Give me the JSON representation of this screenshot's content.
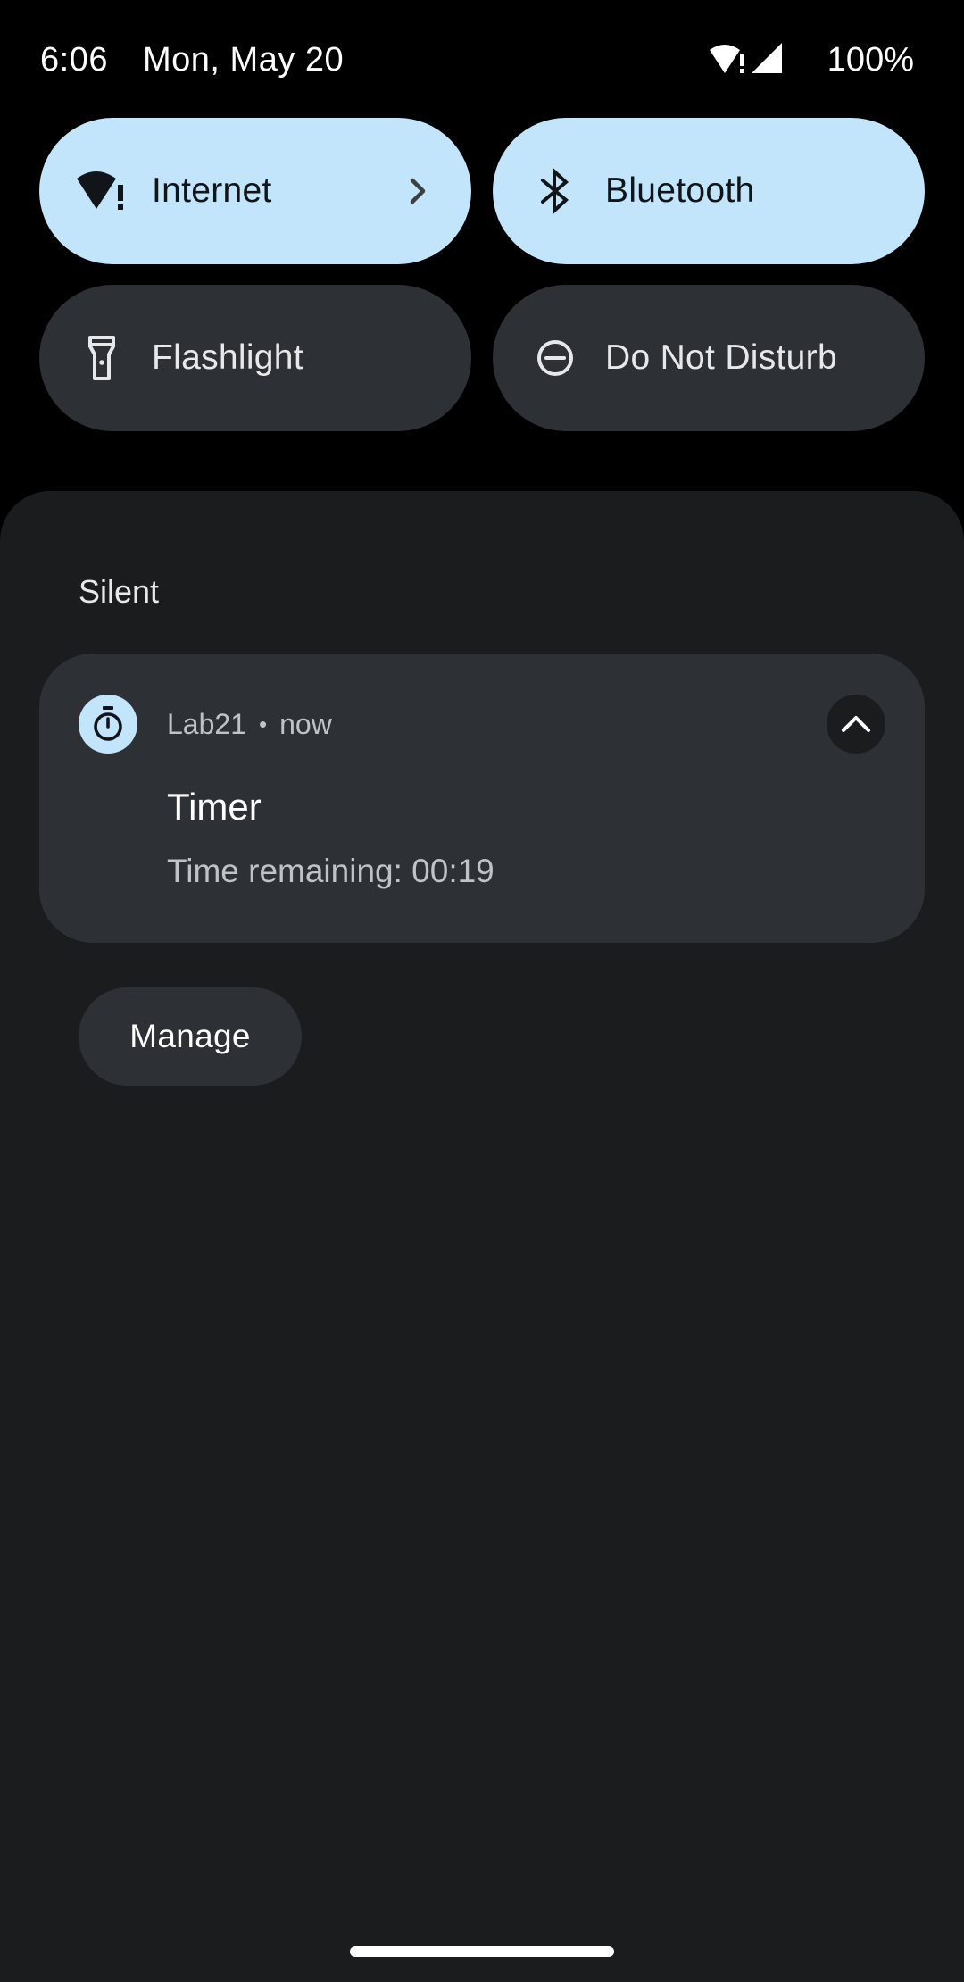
{
  "status_bar": {
    "time": "6:06",
    "date": "Mon, May 20",
    "battery": "100%",
    "icons": [
      "wifi-alert-icon",
      "cell-signal-icon"
    ]
  },
  "quick_settings": {
    "tiles": [
      {
        "label": "Internet",
        "icon": "wifi-alert-icon",
        "state": "active",
        "has_chevron": true
      },
      {
        "label": "Bluetooth",
        "icon": "bluetooth-icon",
        "state": "active"
      },
      {
        "label": "Flashlight",
        "icon": "flashlight-icon",
        "state": "inactive"
      },
      {
        "label": "Do Not Disturb",
        "icon": "do-not-disturb-icon",
        "state": "inactive"
      }
    ]
  },
  "notifications": {
    "section_header": "Silent",
    "items": [
      {
        "app_name": "Lab21",
        "separator": "•",
        "time": "now",
        "title": "Timer",
        "text": "Time remaining: 00:19",
        "icon": "timer-icon",
        "expand_icon": "chevron-up-icon"
      }
    ],
    "manage_label": "Manage"
  },
  "colors": {
    "background": "#000000",
    "shade": "#1a1c1e",
    "tile_active": "#c2e5fb",
    "tile_inactive": "#2d3135",
    "card": "#2d3135"
  }
}
